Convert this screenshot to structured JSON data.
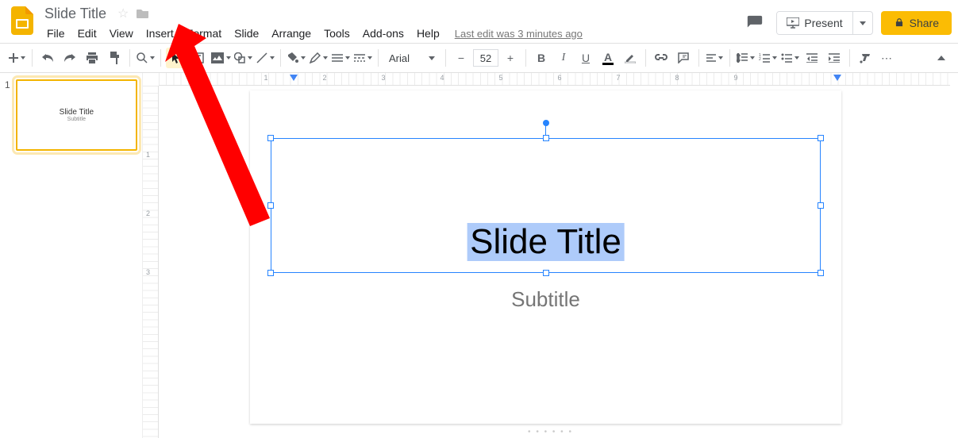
{
  "header": {
    "doc_title": "Slide Title",
    "menus": [
      "File",
      "Edit",
      "View",
      "Insert",
      "Format",
      "Slide",
      "Arrange",
      "Tools",
      "Add-ons",
      "Help"
    ],
    "last_edit": "Last edit was 3 minutes ago",
    "present_label": "Present",
    "share_label": "Share"
  },
  "toolbar": {
    "font_name": "Arial",
    "font_size": "52",
    "bold": "B",
    "italic": "I",
    "underline": "U",
    "text_color_letter": "A"
  },
  "ruler": {
    "h_labels": [
      " ",
      "1",
      "2",
      "3",
      "4",
      "5",
      "6",
      "7",
      "8",
      "9"
    ],
    "v_labels": [
      " ",
      "1",
      "2",
      "3"
    ]
  },
  "filmstrip": {
    "slides": [
      {
        "num": "1",
        "title": "Slide Title",
        "subtitle": "Subtitle"
      }
    ]
  },
  "canvas": {
    "title_text": "Slide Title",
    "subtitle_text": "Subtitle"
  }
}
